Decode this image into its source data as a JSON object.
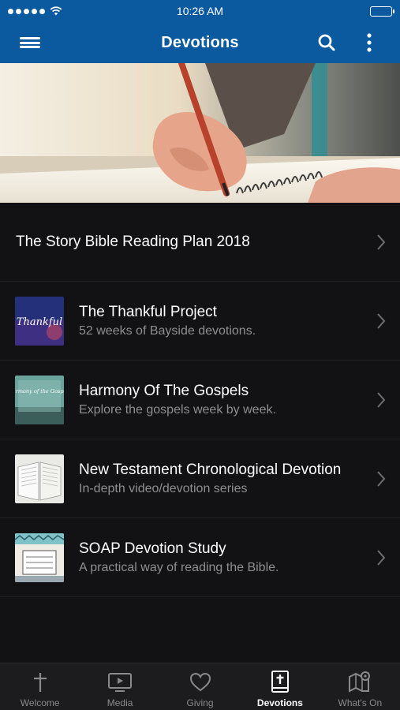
{
  "status_bar": {
    "time": "10:26 AM"
  },
  "nav": {
    "title": "Devotions"
  },
  "featured": {
    "title": "The Story Bible Reading Plan 2018"
  },
  "items": [
    {
      "title": "The Thankful Project",
      "subtitle": "52 weeks of Bayside devotions.",
      "thumb_text": "Thankful"
    },
    {
      "title": "Harmony Of The Gospels",
      "subtitle": "Explore the gospels week by week.",
      "thumb_text": "Harmony of the Gospels"
    },
    {
      "title": "New Testament Chronological Devotion",
      "subtitle": "In-depth video/devotion series"
    },
    {
      "title": "SOAP Devotion Study",
      "subtitle": "A practical way of reading the Bible."
    }
  ],
  "tabs": [
    {
      "label": "Welcome",
      "icon": "cross-icon",
      "active": false
    },
    {
      "label": "Media",
      "icon": "tv-play-icon",
      "active": false
    },
    {
      "label": "Giving",
      "icon": "heart-icon",
      "active": false
    },
    {
      "label": "Devotions",
      "icon": "bible-icon",
      "active": true
    },
    {
      "label": "What's On",
      "icon": "map-pin-icon",
      "active": false
    }
  ],
  "colors": {
    "brand": "#0b5aa0",
    "background": "#121214",
    "tab_bar": "#1c1c1e",
    "subtitle": "#8e8e93"
  }
}
